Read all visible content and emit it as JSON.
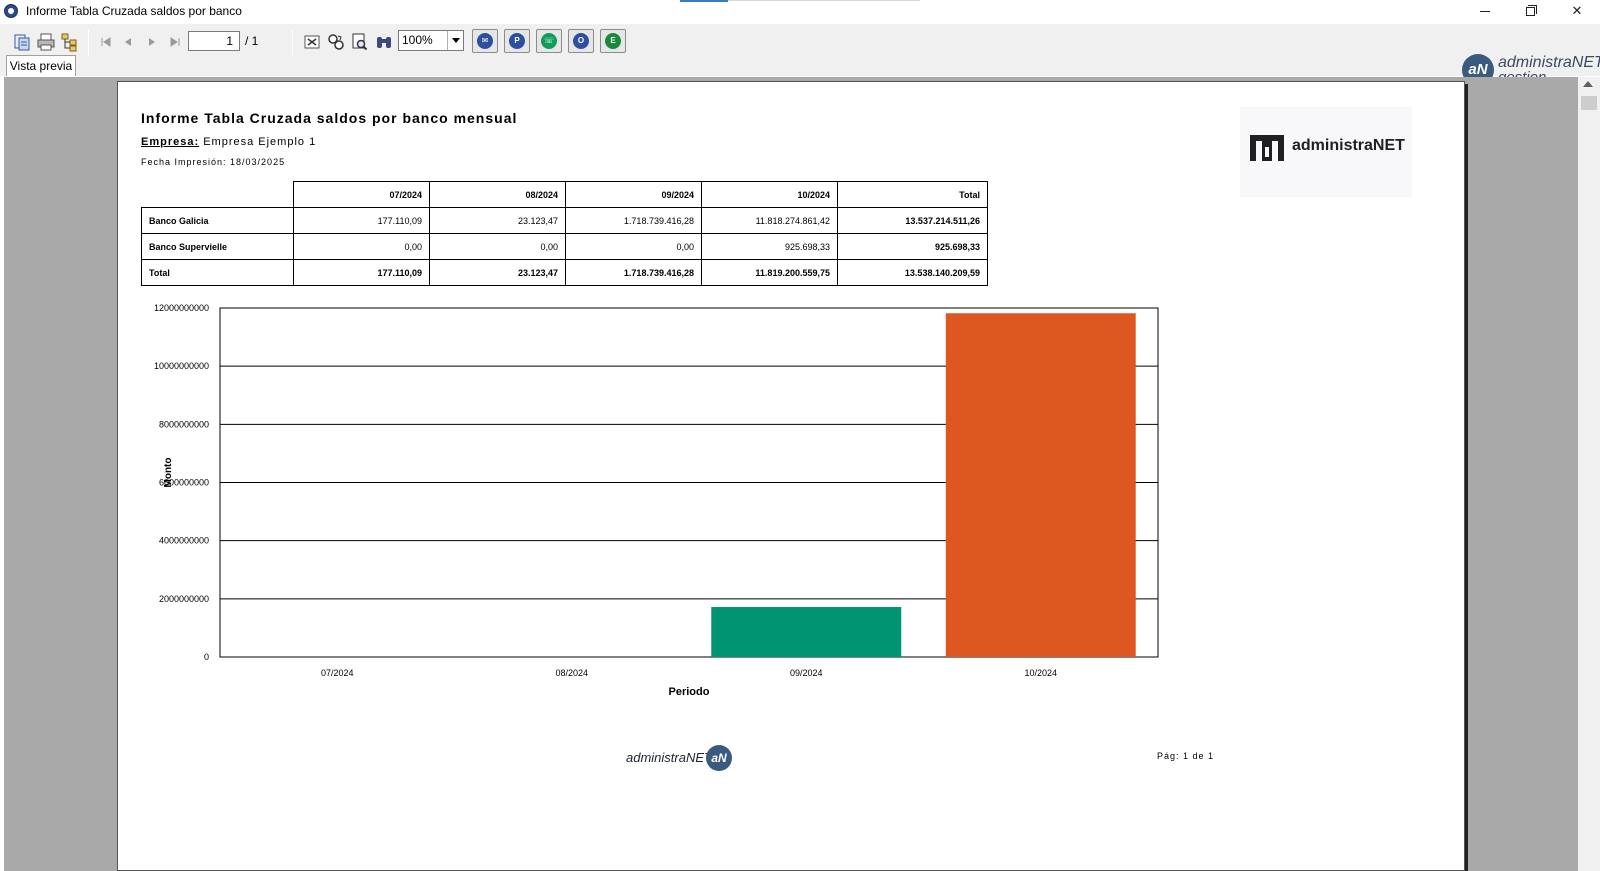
{
  "window": {
    "title": "Informe Tabla Cruzada saldos por banco",
    "minimize_icon": "minimize-icon",
    "restore_icon": "restore-icon",
    "close_glyph": "✕"
  },
  "toolbar": {
    "page_current": "1",
    "page_total": "/ 1",
    "zoom": "100%",
    "tab_label": "Vista previa",
    "brand_initials": "aN",
    "brand_name": "administraNET",
    "brand_sub": "gestion",
    "icons": [
      "export-icon",
      "print-icon",
      "tree-icon",
      "first-page-icon",
      "prev-page-icon",
      "next-page-icon",
      "last-page-icon",
      "close-report-icon",
      "refresh-icon",
      "search-page-icon",
      "binoculars-icon",
      "email-icon",
      "pdf-icon",
      "whatsapp-icon",
      "outlook-icon",
      "excel-icon"
    ],
    "colors": {
      "email": "#2c4f9e",
      "pdf": "#2c4f9e",
      "whatsapp": "#0f9d58",
      "outlook": "#2c4f9e",
      "excel": "#1a8a3a"
    }
  },
  "report": {
    "title": "Informe Tabla Cruzada saldos por banco mensual",
    "company_label": "Empresa:",
    "company_value": "Empresa Ejemplo 1",
    "print_date": "Fecha Impresión: 18/03/2025",
    "logo_text": "administraNET",
    "table": {
      "columns": [
        "07/2024",
        "08/2024",
        "09/2024",
        "10/2024",
        "Total"
      ],
      "rows": [
        {
          "label": "Banco Galicia",
          "values": [
            "177.110,09",
            "23.123,47",
            "1.718.739.416,28",
            "11.818.274.861,42"
          ],
          "total": "13.537.214.511,26"
        },
        {
          "label": "Banco Supervielle",
          "values": [
            "0,00",
            "0,00",
            "0,00",
            "925.698,33"
          ],
          "total": "925.698,33"
        },
        {
          "label": "Total",
          "values": [
            "177.110,09",
            "23.123,47",
            "1.718.739.416,28",
            "11.819.200.559,75"
          ],
          "total": "13.538.140.209,59"
        }
      ]
    },
    "footer_brand": "administraNET",
    "footer_initials": "aN",
    "page_label": "Pág: 1 de 1"
  },
  "chart_data": {
    "type": "bar",
    "categories": [
      "07/2024",
      "08/2024",
      "09/2024",
      "10/2024"
    ],
    "values": [
      177110.09,
      23123.47,
      1718739416.28,
      11819200559.75
    ],
    "colors": [
      "#4472c4",
      "#e3a21a",
      "#009473",
      "#dd5720"
    ],
    "xlabel": "Periodo",
    "ylabel": "Monto",
    "ylim": [
      0,
      12000000000
    ],
    "yticks": [
      0,
      2000000000,
      4000000000,
      6000000000,
      8000000000,
      10000000000,
      12000000000
    ],
    "ytick_labels": [
      "0",
      "2000000000",
      "4000000000",
      "6000000000",
      "8000000000",
      "10000000000",
      "12000000000"
    ],
    "grid": true
  }
}
